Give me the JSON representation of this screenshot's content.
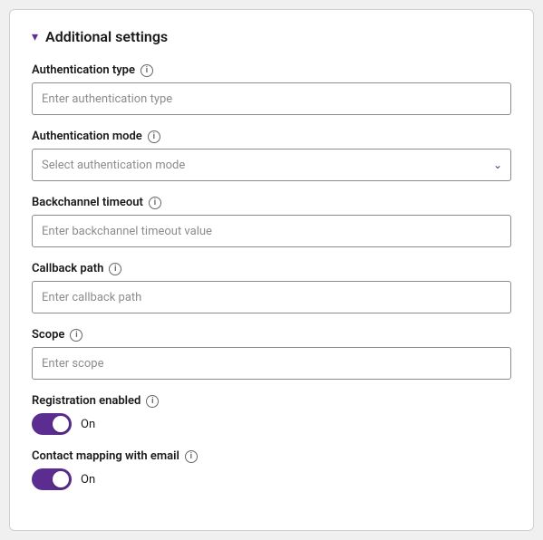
{
  "section": {
    "title": "Additional settings",
    "chevron": "▾"
  },
  "fields": {
    "authentication_type": {
      "label": "Authentication type",
      "placeholder": "Enter authentication type"
    },
    "authentication_mode": {
      "label": "Authentication mode",
      "placeholder": "Select authentication mode"
    },
    "backchannel_timeout": {
      "label": "Backchannel timeout",
      "placeholder": "Enter backchannel timeout value"
    },
    "callback_path": {
      "label": "Callback path",
      "placeholder": "Enter callback path"
    },
    "scope": {
      "label": "Scope",
      "placeholder": "Enter scope"
    },
    "registration_enabled": {
      "label": "Registration enabled",
      "toggle_label": "On",
      "checked": true
    },
    "contact_mapping": {
      "label": "Contact mapping with email",
      "toggle_label": "On",
      "checked": true
    }
  }
}
